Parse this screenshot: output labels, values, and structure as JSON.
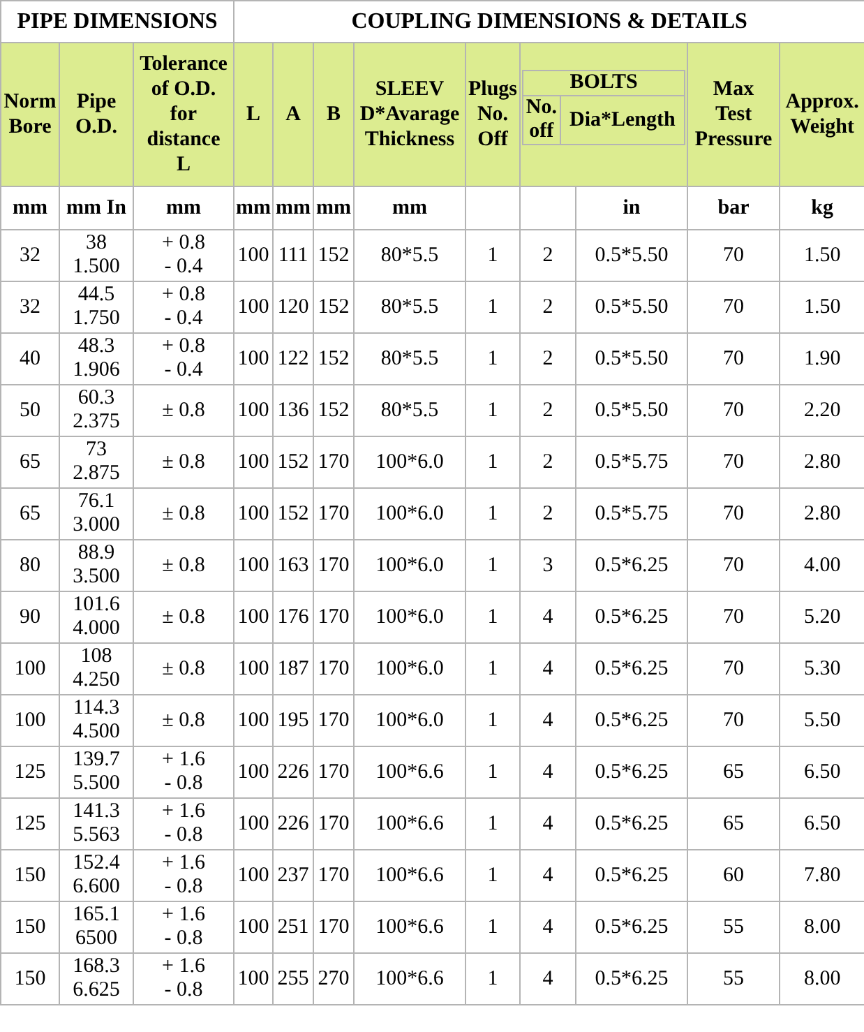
{
  "groups": [
    {
      "label": "PIPE DIMENSIONS"
    },
    {
      "label": "COUPLING DIMENSIONS & DETAILS"
    }
  ],
  "columns": [
    {
      "kind": "plain",
      "label": "Norm\nBore",
      "unit": "mm"
    },
    {
      "kind": "plain",
      "label": "Pipe\nO.D.",
      "unit": "mm In"
    },
    {
      "kind": "plain",
      "label": "Tolerance\nof O.D.\nfor\ndistance\nL",
      "unit": "mm"
    },
    {
      "kind": "plain",
      "label": "L",
      "unit": "mm"
    },
    {
      "kind": "plain",
      "label": "A",
      "unit": "mm"
    },
    {
      "kind": "plain",
      "label": "B",
      "unit": "mm"
    },
    {
      "kind": "plain",
      "label": "SLEEV\nD*Avarage\nThickness",
      "unit": "mm"
    },
    {
      "kind": "plain",
      "label": "Plugs\nNo.\nOff"
    },
    {
      "kind": "group",
      "label": "BOLTS",
      "sub": [
        {
          "label": "No.\noff"
        },
        {
          "label": "Dia*Length",
          "unit": "in"
        }
      ]
    },
    {
      "kind": "plain",
      "label": "Max\nTest\nPressure",
      "unit": "bar"
    },
    {
      "kind": "plain",
      "label": "Approx.\nWeight",
      "unit": "kg"
    }
  ],
  "rows": [
    [
      "32",
      "38\n1.500",
      "+ 0.8\n- 0.4",
      "100",
      "111",
      "152",
      "80*5.5",
      "1",
      "2",
      "0.5*5.50",
      "70",
      "1.50"
    ],
    [
      "32",
      "44.5\n1.750",
      "+ 0.8\n- 0.4",
      "100",
      "120",
      "152",
      "80*5.5",
      "1",
      "2",
      "0.5*5.50",
      "70",
      "1.50"
    ],
    [
      "40",
      "48.3\n1.906",
      "+ 0.8\n- 0.4",
      "100",
      "122",
      "152",
      "80*5.5",
      "1",
      "2",
      "0.5*5.50",
      "70",
      "1.90"
    ],
    [
      "50",
      "60.3\n2.375",
      "± 0.8",
      "100",
      "136",
      "152",
      "80*5.5",
      "1",
      "2",
      "0.5*5.50",
      "70",
      "2.20"
    ],
    [
      "65",
      "73\n2.875",
      "± 0.8",
      "100",
      "152",
      "170",
      "100*6.0",
      "1",
      "2",
      "0.5*5.75",
      "70",
      "2.80"
    ],
    [
      "65",
      "76.1\n3.000",
      "± 0.8",
      "100",
      "152",
      "170",
      "100*6.0",
      "1",
      "2",
      "0.5*5.75",
      "70",
      "2.80"
    ],
    [
      "80",
      "88.9\n3.500",
      "± 0.8",
      "100",
      "163",
      "170",
      "100*6.0",
      "1",
      "3",
      "0.5*6.25",
      "70",
      "4.00"
    ],
    [
      "90",
      "101.6\n4.000",
      "± 0.8",
      "100",
      "176",
      "170",
      "100*6.0",
      "1",
      "4",
      "0.5*6.25",
      "70",
      "5.20"
    ],
    [
      "100",
      "108\n4.250",
      "± 0.8",
      "100",
      "187",
      "170",
      "100*6.0",
      "1",
      "4",
      "0.5*6.25",
      "70",
      "5.30"
    ],
    [
      "100",
      "114.3\n4.500",
      "± 0.8",
      "100",
      "195",
      "170",
      "100*6.0",
      "1",
      "4",
      "0.5*6.25",
      "70",
      "5.50"
    ],
    [
      "125",
      "139.7\n5.500",
      "+ 1.6\n- 0.8",
      "100",
      "226",
      "170",
      "100*6.6",
      "1",
      "4",
      "0.5*6.25",
      "65",
      "6.50"
    ],
    [
      "125",
      "141.3\n5.563",
      "+ 1.6\n- 0.8",
      "100",
      "226",
      "170",
      "100*6.6",
      "1",
      "4",
      "0.5*6.25",
      "65",
      "6.50"
    ],
    [
      "150",
      "152.4\n6.600",
      "+ 1.6\n- 0.8",
      "100",
      "237",
      "170",
      "100*6.6",
      "1",
      "4",
      "0.5*6.25",
      "60",
      "7.80"
    ],
    [
      "150",
      "165.1\n6500",
      "+ 1.6\n- 0.8",
      "100",
      "251",
      "170",
      "100*6.6",
      "1",
      "4",
      "0.5*6.25",
      "55",
      "8.00"
    ],
    [
      "150",
      "168.3\n6.625",
      "+ 1.6\n- 0.8",
      "100",
      "255",
      "270",
      "100*6.6",
      "1",
      "4",
      "0.5*6.25",
      "55",
      "8.00"
    ]
  ]
}
